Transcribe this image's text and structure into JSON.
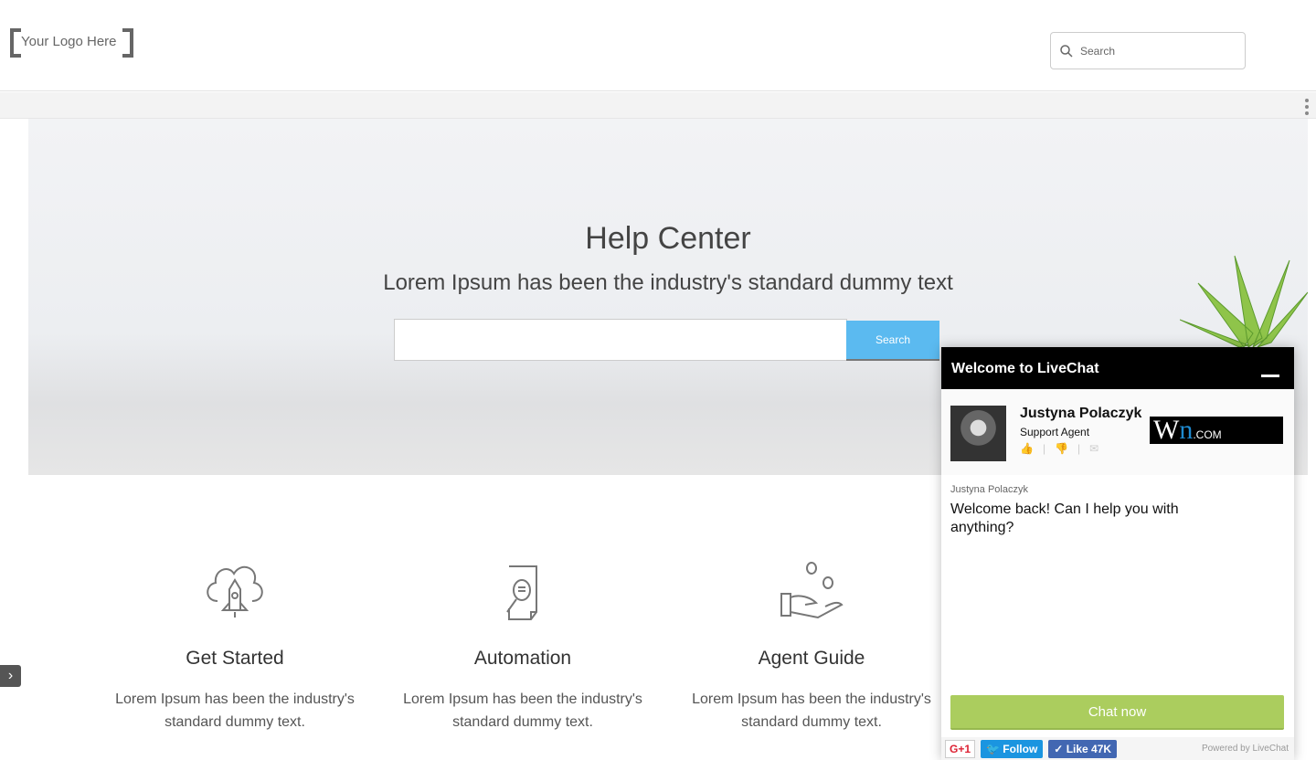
{
  "header": {
    "logo": "Your Logo Here",
    "search_placeholder": "Search"
  },
  "hero": {
    "title": "Help Center",
    "subtitle": "Lorem Ipsum has been the industry's standard dummy text",
    "search_button": "Search",
    "search_value": ""
  },
  "cards": [
    {
      "icon": "cloud-rocket-icon",
      "title": "Get Started",
      "text": "Lorem Ipsum has been the industry's standard dummy text."
    },
    {
      "icon": "document-search-icon",
      "title": "Automation",
      "text": "Lorem Ipsum has been the industry's standard dummy text."
    },
    {
      "icon": "hand-coins-icon",
      "title": "Agent Guide",
      "text": "Lorem Ipsum has been the industry's standard dummy text."
    }
  ],
  "chat": {
    "title": "Welcome to LiveChat",
    "agent_name": "Justyna Polaczyk",
    "agent_role": "Support Agent",
    "logo": "WN.com",
    "message_author": "Justyna Polaczyk",
    "message": "Welcome back! Can I help you with anything?",
    "chat_button": "Chat now",
    "gplus": "G+1",
    "follow": "Follow",
    "like": "Like 47K",
    "powered": "Powered by LiveChat"
  },
  "colors": {
    "search_button": "#5bbaf0",
    "chat_button": "#abcd5e",
    "chat_header": "#000000"
  }
}
